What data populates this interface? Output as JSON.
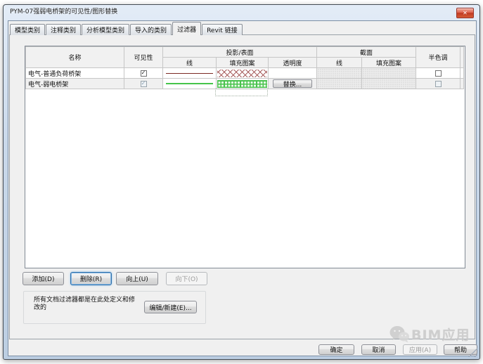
{
  "window": {
    "title": "PYM-07强弱电桥架的可见性/图形替换",
    "close_glyph": "✕"
  },
  "tabs": {
    "items": [
      {
        "label": "模型类别",
        "active": false
      },
      {
        "label": "注释类别",
        "active": false
      },
      {
        "label": "分析模型类别",
        "active": false
      },
      {
        "label": "导入的类别",
        "active": false
      },
      {
        "label": "过滤器",
        "active": true
      },
      {
        "label": "Revit 链接",
        "active": false
      }
    ]
  },
  "table": {
    "headers": {
      "name": "名称",
      "visibility": "可见性",
      "projection_group": "投影/表面",
      "section_group": "截面",
      "lines": "线",
      "patterns": "填充图案",
      "transparency": "透明度",
      "halftone": "半色调"
    },
    "rows": [
      {
        "name": "电气-普通负荷桥架",
        "visibility_check": "✓",
        "line_color": "#7b2a24",
        "pattern": "red-crosshatch",
        "halftone_check": ""
      },
      {
        "name": "电气-弱电桥架",
        "visibility_check": "✓",
        "line_color": "#46c54a",
        "pattern": "green-grid",
        "transparency_button": "替换...",
        "halftone_check": ""
      }
    ]
  },
  "action_buttons": {
    "add": "添加(D)",
    "delete": "删除(R)",
    "up": "向上(U)",
    "down": "向下(O)"
  },
  "filter_note": {
    "text": "所有文档过滤器都是在此处定义和修改的",
    "edit_button": "编辑/新建(E)..."
  },
  "footer": {
    "ok": "确定",
    "cancel": "取消",
    "apply": "应用(A)",
    "help": "帮助"
  },
  "watermark": {
    "text": "BIM应用"
  },
  "colors": {
    "titlebar": "#c9d8ea",
    "dialog_bg": "#f0f0f0",
    "row1_line": "#7b2a24",
    "row1_pattern": "#a85f5f",
    "row2_line": "#46c54a",
    "row2_pattern": "#49c24d",
    "disabled_cell": "#ececec",
    "close_button": "#d0452e",
    "focus_ring": "#2f6fa8"
  }
}
